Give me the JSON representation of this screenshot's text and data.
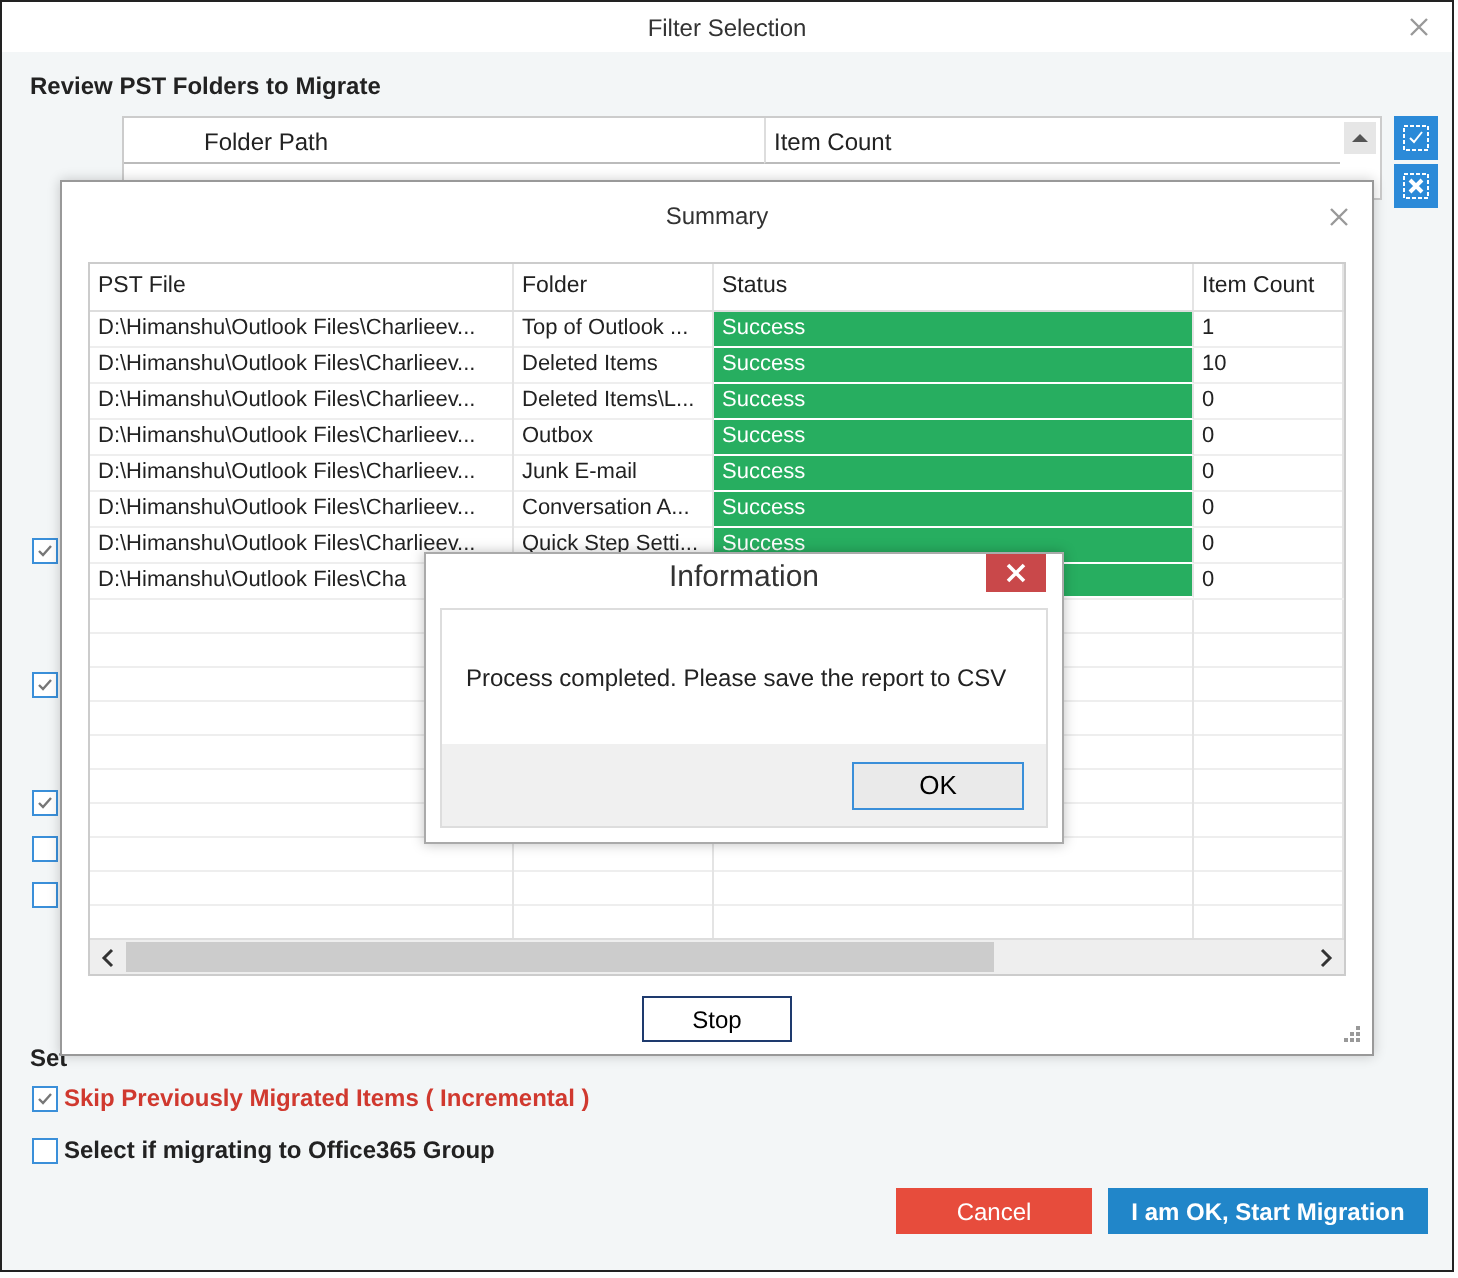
{
  "window": {
    "title": "Filter Selection"
  },
  "heading": "Review PST Folders to Migrate",
  "folder_table": {
    "columns": [
      "Folder Path",
      "Item Count"
    ]
  },
  "options": [
    {
      "checked": true
    },
    {
      "checked": true
    },
    {
      "checked": true
    },
    {
      "checked": false
    },
    {
      "checked": false
    }
  ],
  "settings_heading": "Set",
  "settings": [
    {
      "label": "Skip Previously Migrated Items ( Incremental )",
      "checked": true,
      "kind": "warning"
    },
    {
      "label": "Select if migrating to Office365 Group",
      "checked": false,
      "kind": "normal"
    }
  ],
  "buttons": [
    {
      "label": "Cancel",
      "kind": "cancel"
    },
    {
      "label": "I am OK, Start Migration",
      "kind": "primary"
    }
  ],
  "summary": {
    "title": "Summary",
    "columns": [
      "PST File",
      "Folder",
      "Status",
      "Item Count"
    ],
    "rows": [
      {
        "pst_file": "D:\\Himanshu\\Outlook Files\\Charlieev...",
        "folder": "Top of Outlook ...",
        "status": "Success",
        "color": "#27ae60",
        "item_count": "1"
      },
      {
        "pst_file": "D:\\Himanshu\\Outlook Files\\Charlieev...",
        "folder": "Deleted Items",
        "status": "Success",
        "color": "#27ae60",
        "item_count": "10"
      },
      {
        "pst_file": "D:\\Himanshu\\Outlook Files\\Charlieev...",
        "folder": "Deleted Items\\L...",
        "status": "Success",
        "color": "#27ae60",
        "item_count": "0"
      },
      {
        "pst_file": "D:\\Himanshu\\Outlook Files\\Charlieev...",
        "folder": "Outbox",
        "status": "Success",
        "color": "#27ae60",
        "item_count": "0"
      },
      {
        "pst_file": "D:\\Himanshu\\Outlook Files\\Charlieev...",
        "folder": "Junk E-mail",
        "status": "Success",
        "color": "#27ae60",
        "item_count": "0"
      },
      {
        "pst_file": "D:\\Himanshu\\Outlook Files\\Charlieev...",
        "folder": "Conversation A...",
        "status": "Success",
        "color": "#27ae60",
        "item_count": "0"
      },
      {
        "pst_file": "D:\\Himanshu\\Outlook Files\\Charlieev...",
        "folder": "Quick Step Setti...",
        "status": "Success",
        "color": "#27ae60",
        "item_count": "0"
      },
      {
        "pst_file": "D:\\Himanshu\\Outlook Files\\Cha",
        "color": "#27ae60",
        "item_count": "0"
      }
    ],
    "stop_button": "Stop"
  },
  "dialog": {
    "title": "Information",
    "message": "Process completed. Please save the report to CSV",
    "button": "OK"
  }
}
